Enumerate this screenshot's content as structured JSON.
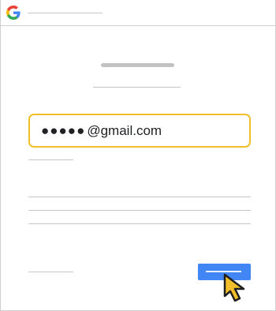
{
  "email": {
    "masked_prefix": "●●●●●",
    "domain_suffix": "@gmail.com"
  },
  "icons": {
    "brand": "google-g-icon",
    "cursor": "mouse-pointer-icon"
  },
  "colors": {
    "focus_border": "#f2bf2b",
    "primary_button": "#4285f4",
    "placeholder_lines": "#c7c7c7",
    "cursor_fill": "#f2bf2b"
  }
}
